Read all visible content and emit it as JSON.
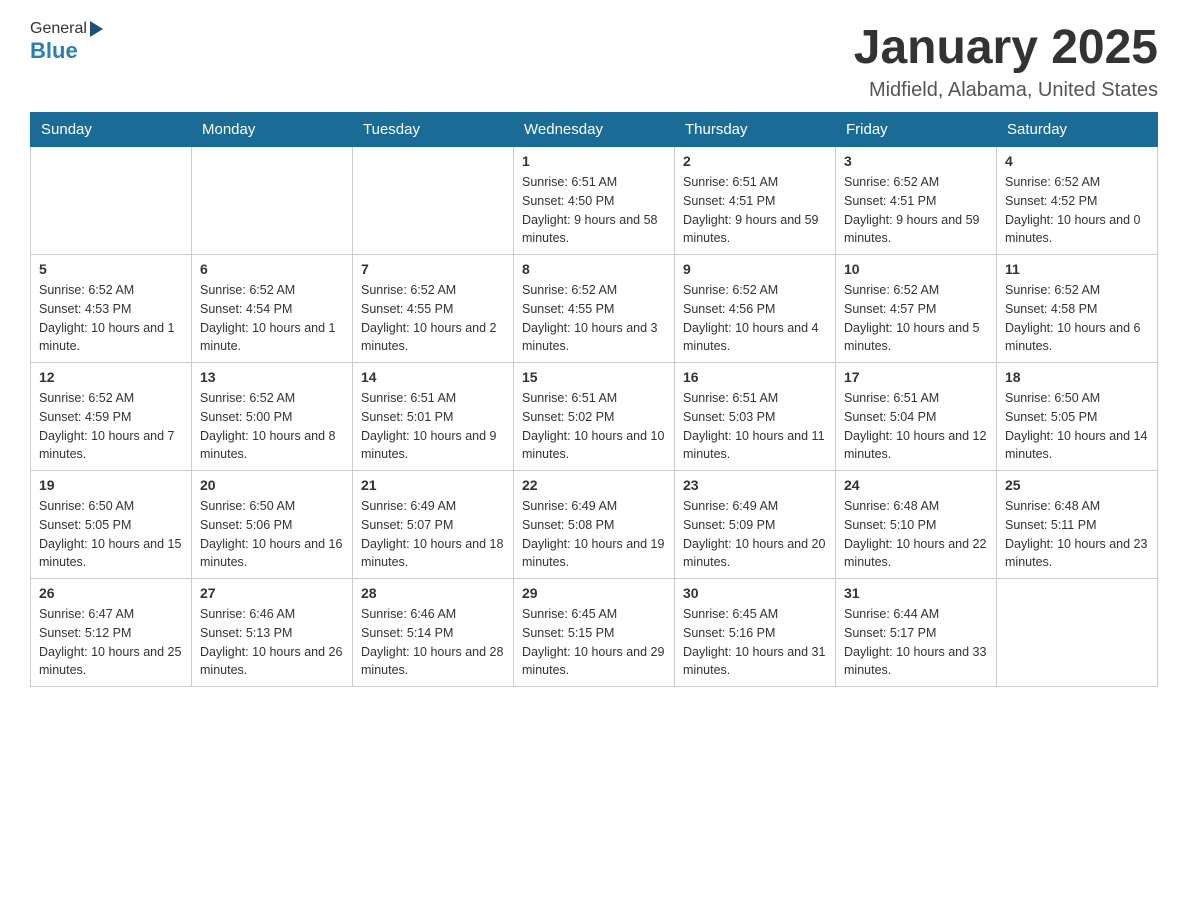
{
  "logo": {
    "general": "General",
    "blue": "Blue"
  },
  "header": {
    "title": "January 2025",
    "subtitle": "Midfield, Alabama, United States"
  },
  "calendar": {
    "days_of_week": [
      "Sunday",
      "Monday",
      "Tuesday",
      "Wednesday",
      "Thursday",
      "Friday",
      "Saturday"
    ],
    "weeks": [
      [
        {
          "day": "",
          "info": ""
        },
        {
          "day": "",
          "info": ""
        },
        {
          "day": "",
          "info": ""
        },
        {
          "day": "1",
          "info": "Sunrise: 6:51 AM\nSunset: 4:50 PM\nDaylight: 9 hours and 58 minutes."
        },
        {
          "day": "2",
          "info": "Sunrise: 6:51 AM\nSunset: 4:51 PM\nDaylight: 9 hours and 59 minutes."
        },
        {
          "day": "3",
          "info": "Sunrise: 6:52 AM\nSunset: 4:51 PM\nDaylight: 9 hours and 59 minutes."
        },
        {
          "day": "4",
          "info": "Sunrise: 6:52 AM\nSunset: 4:52 PM\nDaylight: 10 hours and 0 minutes."
        }
      ],
      [
        {
          "day": "5",
          "info": "Sunrise: 6:52 AM\nSunset: 4:53 PM\nDaylight: 10 hours and 1 minute."
        },
        {
          "day": "6",
          "info": "Sunrise: 6:52 AM\nSunset: 4:54 PM\nDaylight: 10 hours and 1 minute."
        },
        {
          "day": "7",
          "info": "Sunrise: 6:52 AM\nSunset: 4:55 PM\nDaylight: 10 hours and 2 minutes."
        },
        {
          "day": "8",
          "info": "Sunrise: 6:52 AM\nSunset: 4:55 PM\nDaylight: 10 hours and 3 minutes."
        },
        {
          "day": "9",
          "info": "Sunrise: 6:52 AM\nSunset: 4:56 PM\nDaylight: 10 hours and 4 minutes."
        },
        {
          "day": "10",
          "info": "Sunrise: 6:52 AM\nSunset: 4:57 PM\nDaylight: 10 hours and 5 minutes."
        },
        {
          "day": "11",
          "info": "Sunrise: 6:52 AM\nSunset: 4:58 PM\nDaylight: 10 hours and 6 minutes."
        }
      ],
      [
        {
          "day": "12",
          "info": "Sunrise: 6:52 AM\nSunset: 4:59 PM\nDaylight: 10 hours and 7 minutes."
        },
        {
          "day": "13",
          "info": "Sunrise: 6:52 AM\nSunset: 5:00 PM\nDaylight: 10 hours and 8 minutes."
        },
        {
          "day": "14",
          "info": "Sunrise: 6:51 AM\nSunset: 5:01 PM\nDaylight: 10 hours and 9 minutes."
        },
        {
          "day": "15",
          "info": "Sunrise: 6:51 AM\nSunset: 5:02 PM\nDaylight: 10 hours and 10 minutes."
        },
        {
          "day": "16",
          "info": "Sunrise: 6:51 AM\nSunset: 5:03 PM\nDaylight: 10 hours and 11 minutes."
        },
        {
          "day": "17",
          "info": "Sunrise: 6:51 AM\nSunset: 5:04 PM\nDaylight: 10 hours and 12 minutes."
        },
        {
          "day": "18",
          "info": "Sunrise: 6:50 AM\nSunset: 5:05 PM\nDaylight: 10 hours and 14 minutes."
        }
      ],
      [
        {
          "day": "19",
          "info": "Sunrise: 6:50 AM\nSunset: 5:05 PM\nDaylight: 10 hours and 15 minutes."
        },
        {
          "day": "20",
          "info": "Sunrise: 6:50 AM\nSunset: 5:06 PM\nDaylight: 10 hours and 16 minutes."
        },
        {
          "day": "21",
          "info": "Sunrise: 6:49 AM\nSunset: 5:07 PM\nDaylight: 10 hours and 18 minutes."
        },
        {
          "day": "22",
          "info": "Sunrise: 6:49 AM\nSunset: 5:08 PM\nDaylight: 10 hours and 19 minutes."
        },
        {
          "day": "23",
          "info": "Sunrise: 6:49 AM\nSunset: 5:09 PM\nDaylight: 10 hours and 20 minutes."
        },
        {
          "day": "24",
          "info": "Sunrise: 6:48 AM\nSunset: 5:10 PM\nDaylight: 10 hours and 22 minutes."
        },
        {
          "day": "25",
          "info": "Sunrise: 6:48 AM\nSunset: 5:11 PM\nDaylight: 10 hours and 23 minutes."
        }
      ],
      [
        {
          "day": "26",
          "info": "Sunrise: 6:47 AM\nSunset: 5:12 PM\nDaylight: 10 hours and 25 minutes."
        },
        {
          "day": "27",
          "info": "Sunrise: 6:46 AM\nSunset: 5:13 PM\nDaylight: 10 hours and 26 minutes."
        },
        {
          "day": "28",
          "info": "Sunrise: 6:46 AM\nSunset: 5:14 PM\nDaylight: 10 hours and 28 minutes."
        },
        {
          "day": "29",
          "info": "Sunrise: 6:45 AM\nSunset: 5:15 PM\nDaylight: 10 hours and 29 minutes."
        },
        {
          "day": "30",
          "info": "Sunrise: 6:45 AM\nSunset: 5:16 PM\nDaylight: 10 hours and 31 minutes."
        },
        {
          "day": "31",
          "info": "Sunrise: 6:44 AM\nSunset: 5:17 PM\nDaylight: 10 hours and 33 minutes."
        },
        {
          "day": "",
          "info": ""
        }
      ]
    ]
  }
}
